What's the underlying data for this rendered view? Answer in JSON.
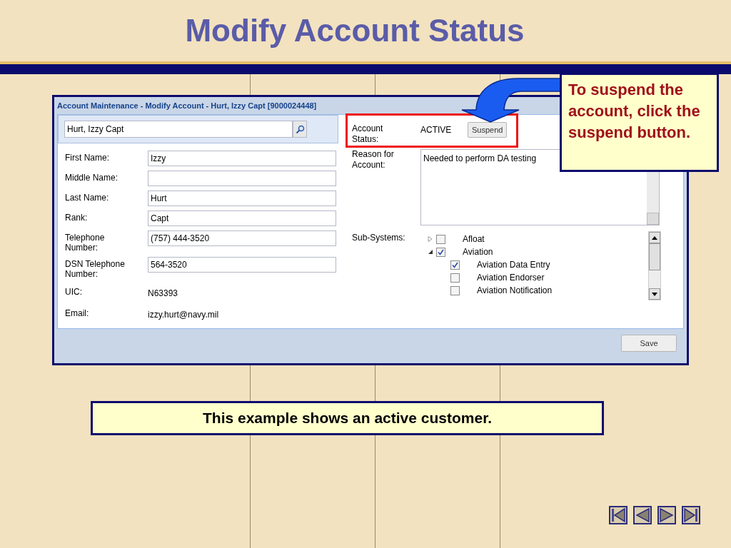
{
  "slide": {
    "title": "Modify Account Status"
  },
  "window": {
    "title": "Account Maintenance - Modify Account - Hurt, Izzy Capt [9000024448]",
    "search": {
      "value": "Hurt, Izzy Capt"
    },
    "fields": [
      {
        "label": "First Name:",
        "kind": "input",
        "value": "Izzy"
      },
      {
        "label": "Middle Name:",
        "kind": "input"
      },
      {
        "label": "Last Name:",
        "kind": "input",
        "value": "Hurt"
      },
      {
        "label": "Rank:",
        "kind": "input",
        "value": "Capt"
      },
      {
        "label": "Telephone Number:",
        "kind": "input",
        "value": "(757) 444-3520"
      },
      {
        "label": "DSN Telephone Number:",
        "kind": "input",
        "value": "564-3520"
      },
      {
        "label": "UIC:",
        "kind": "text",
        "value": "N63393"
      },
      {
        "label": "Email:",
        "kind": "text",
        "value": "izzy.hurt@navy.mil"
      }
    ],
    "account_status": {
      "label": "Account Status:",
      "value": "ACTIVE",
      "button": "Suspend"
    },
    "reason": {
      "label": "Reason for Account:",
      "value": "Needed to perform DA testing"
    },
    "sub_systems": {
      "label": "Sub-Systems:",
      "items": [
        {
          "label": "Afloat",
          "checked": false,
          "expanded": false
        },
        {
          "label": "Aviation",
          "checked": true,
          "expanded": true,
          "children": [
            {
              "label": "Aviation Data Entry",
              "checked": true
            },
            {
              "label": "Aviation Endorser",
              "checked": false
            },
            {
              "label": "Aviation Notification",
              "checked": false
            }
          ]
        }
      ]
    },
    "save_button": "Save"
  },
  "callout": "To suspend the account, click the suspend button.",
  "caption": "This example shows an active customer."
}
